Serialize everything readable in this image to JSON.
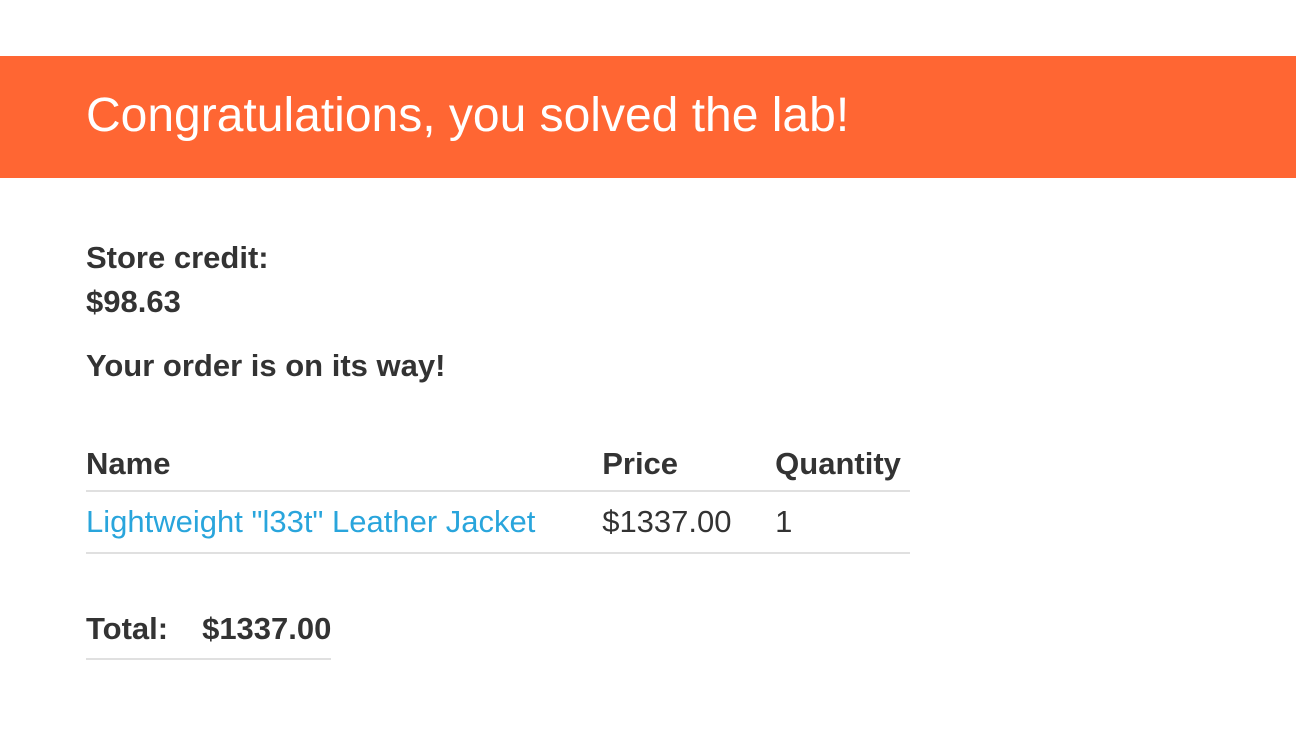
{
  "banner": {
    "title": "Congratulations, you solved the lab!",
    "color": "#ff6633"
  },
  "account": {
    "store_credit_label": "Store credit:",
    "store_credit_value": "$98.63"
  },
  "order": {
    "status": "Your order is on its way!",
    "columns": [
      "Name",
      "Price",
      "Quantity"
    ],
    "items": [
      {
        "name": "Lightweight \"l33t\" Leather Jacket",
        "price": "$1337.00",
        "quantity": "1"
      }
    ],
    "total_label": "Total:",
    "total_value": "$1337.00"
  },
  "colors": {
    "link": "#29a5dc",
    "text": "#333333",
    "divider": "#e0e0e0"
  }
}
